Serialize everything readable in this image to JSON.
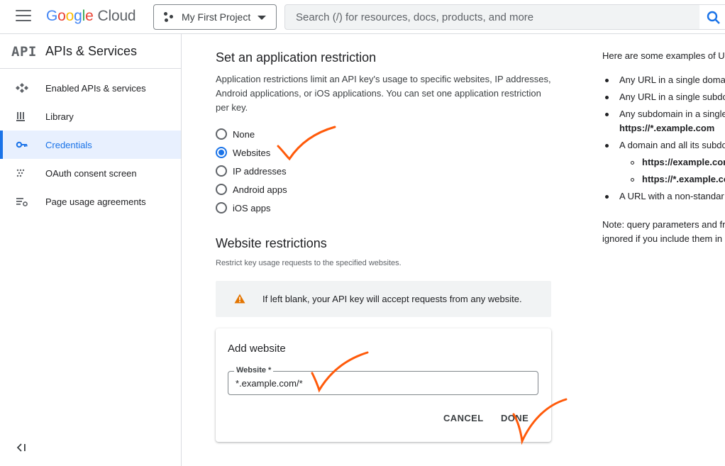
{
  "header": {
    "logo_google": "Google",
    "logo_cloud": "Cloud",
    "project_label": "My First Project",
    "search_placeholder": "Search (/) for resources, docs, products, and more"
  },
  "sidebar": {
    "badge": "API",
    "title": "APIs & Services",
    "items": [
      {
        "label": "Enabled APIs & services",
        "icon": "apis-icon",
        "active": false
      },
      {
        "label": "Library",
        "icon": "library-icon",
        "active": false
      },
      {
        "label": "Credentials",
        "icon": "key-icon",
        "active": true
      },
      {
        "label": "OAuth consent screen",
        "icon": "consent-icon",
        "active": false
      },
      {
        "label": "Page usage agreements",
        "icon": "settings-list-icon",
        "active": false
      }
    ],
    "collapse_glyph": "<I"
  },
  "restriction": {
    "title": "Set an application restriction",
    "description": "Application restrictions limit an API key's usage to specific websites, IP addresses, Android applications, or iOS applications. You can set one application restriction per key.",
    "options": [
      {
        "label": "None",
        "checked": false
      },
      {
        "label": "Websites",
        "checked": true
      },
      {
        "label": "IP addresses",
        "checked": false
      },
      {
        "label": "Android apps",
        "checked": false
      },
      {
        "label": "iOS apps",
        "checked": false
      }
    ]
  },
  "website": {
    "title": "Website restrictions",
    "description": "Restrict key usage requests to the specified websites.",
    "warning": "If left blank, your API key will accept requests from any website.",
    "card_title": "Add website",
    "field_label": "Website *",
    "field_value": "*.example.com/*",
    "cancel_label": "CANCEL",
    "done_label": "DONE"
  },
  "info": {
    "intro": "Here are some examples of UI",
    "items": [
      {
        "text": "Any URL in a single domai",
        "level": 1
      },
      {
        "text": "Any URL in a single subdo",
        "level": 1
      },
      {
        "text": "Any subdomain in a single",
        "level": 1
      },
      {
        "text": "https://*.example.com",
        "level": 0,
        "bold": true
      },
      {
        "text": "A domain and all its subdo",
        "level": 1
      },
      {
        "text": "https://example.com",
        "level": 2,
        "bold": true
      },
      {
        "text": "https://*.example.co",
        "level": 2,
        "bold": true
      },
      {
        "text": "A URL with a non-standar",
        "level": 1
      }
    ],
    "note_line1": "Note: query parameters and fr",
    "note_line2": "ignored if you include them in"
  },
  "colors": {
    "accent": "#1a73e8",
    "annotation": "#ff5a0a",
    "warning": "#e37400"
  }
}
